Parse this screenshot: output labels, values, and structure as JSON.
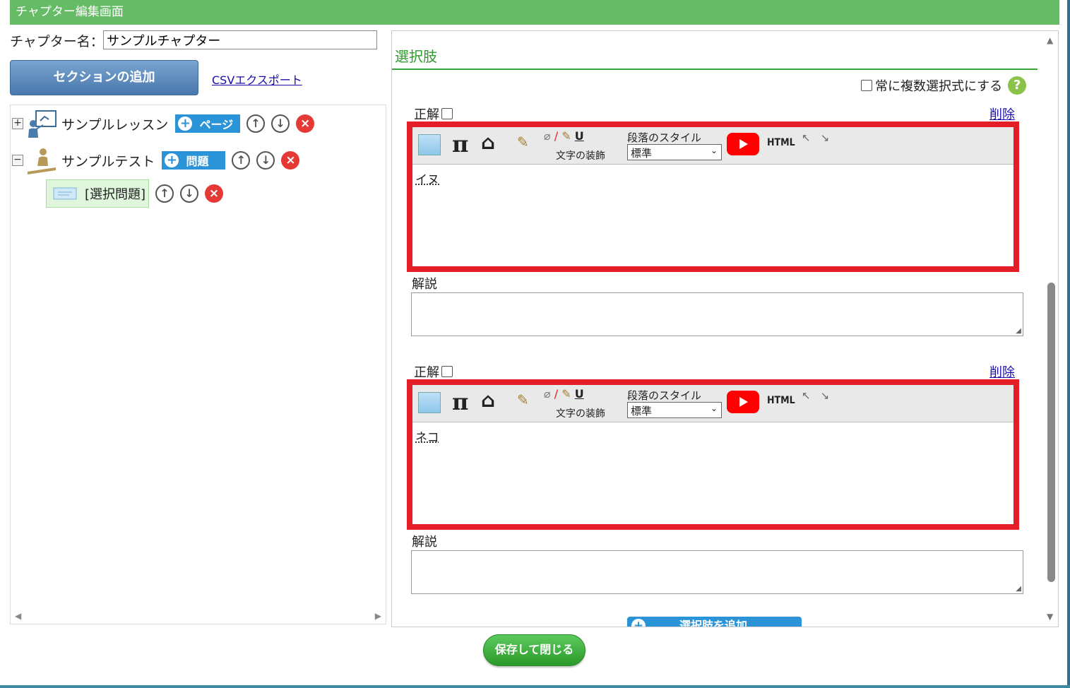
{
  "header": {
    "title": "チャプター編集画面"
  },
  "chapter": {
    "label": "チャプター名：",
    "name_value": "サンプルチャプター"
  },
  "actions": {
    "add_section": "セクションの追加",
    "csv_export": "CSVエクスポート",
    "save_close": "保存して閉じる"
  },
  "tree": {
    "lesson": {
      "label": "サンプルレッスン",
      "add_label": "ページ",
      "expander": "+"
    },
    "test": {
      "label": "サンプルテスト",
      "add_label": "問題",
      "expander": "−"
    },
    "question": {
      "label": "[選択問題]"
    }
  },
  "choices_section": {
    "title": "選択肢",
    "multi_select_label": "常に複数選択式にする",
    "help": "?",
    "add_choice": "選択肢を追加",
    "colors": {
      "accent": "#39a339",
      "highlight_frame": "#e41e26",
      "button_blue": "#2b93d8"
    }
  },
  "choice_labels": {
    "correct": "正解",
    "delete": "削除",
    "explanation": "解説",
    "text_decoration": "文字の装飾",
    "paragraph_style": "段落のスタイル",
    "paragraph_value": "標準",
    "html": "HTML",
    "pi": "π"
  },
  "choices": [
    {
      "content": "イヌ"
    },
    {
      "content": "ネコ"
    }
  ]
}
